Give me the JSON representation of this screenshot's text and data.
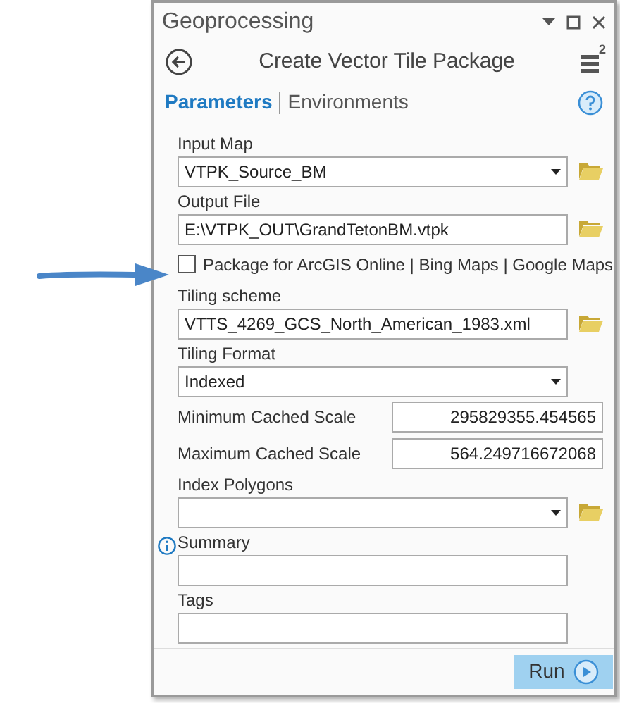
{
  "window": {
    "title": "Geoprocessing"
  },
  "tool": {
    "title": "Create Vector Tile Package",
    "badge": "2"
  },
  "tabs": [
    {
      "label": "Parameters",
      "selected": true
    },
    {
      "label": "Environments",
      "selected": false
    }
  ],
  "parameters": [
    {
      "kind": "dropdown",
      "label": "Input Map",
      "value": "VTPK_Source_BM",
      "browse": true
    },
    {
      "kind": "text",
      "label": "Output File",
      "value": "E:\\VTPK_OUT\\GrandTetonBM.vtpk",
      "browse": true
    },
    {
      "kind": "checkbox",
      "label": "Package for ArcGIS Online | Bing Maps | Google Maps",
      "checked": false
    },
    {
      "kind": "text",
      "label": "Tiling scheme",
      "value": "VTTS_4269_GCS_North_American_1983.xml",
      "browse": true
    },
    {
      "kind": "dropdown",
      "label": "Tiling Format",
      "value": "Indexed",
      "browse": false
    },
    {
      "kind": "inline",
      "label": "Minimum Cached Scale",
      "value": "295829355.454565"
    },
    {
      "kind": "inline",
      "label": "Maximum Cached Scale",
      "value": "564.249716672068"
    },
    {
      "kind": "dropdown",
      "label": "Index Polygons",
      "browse": true
    },
    {
      "kind": "text",
      "label": "Summary",
      "info": true,
      "browse": false
    },
    {
      "kind": "text",
      "label": "Tags",
      "browse": false
    }
  ],
  "run_button": {
    "label": "Run"
  }
}
